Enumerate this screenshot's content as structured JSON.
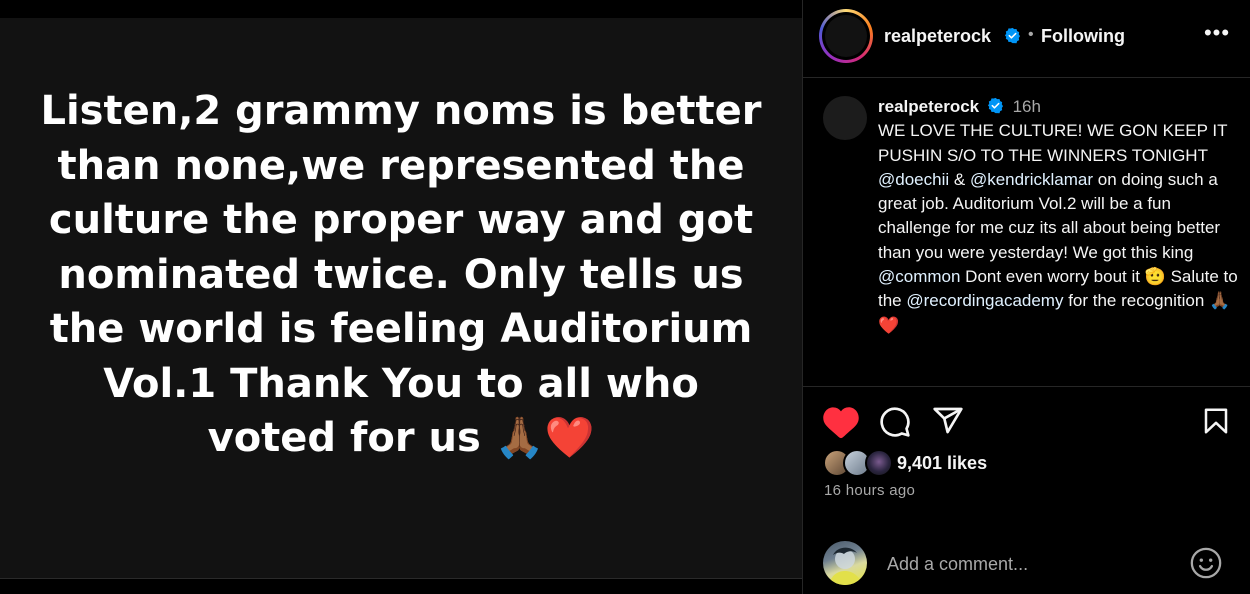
{
  "post": {
    "image_text": "Listen,2 grammy noms is better than none,we represented the culture the proper way and got nominated twice. Only tells us the world is feeling Auditorium Vol.1 Thank You to all who voted for us",
    "image_emoji": "🙏🏾❤️"
  },
  "header": {
    "username": "realpeterock",
    "separator": "•",
    "follow_status": "Following",
    "more": "•••"
  },
  "caption": {
    "username": "realpeterock",
    "time": "16h",
    "text_1": "WE LOVE THE CULTURE! WE GON KEEP IT PUSHIN S/O TO THE WINNERS TONIGHT ",
    "mention_1": "@doechii",
    "text_2": " & ",
    "mention_2": "@kendricklamar",
    "text_3": " on doing such a great job. Auditorium Vol.2 will be a fun challenge for me cuz its all about being better than you were yesterday! We got this king ",
    "mention_3": "@common",
    "text_4": " Dont even worry bout it 🫡 Salute to the ",
    "mention_4": "@recordingacademy",
    "text_5": " for the recognition 🙏🏾❤️"
  },
  "engagement": {
    "likes": "9,401 likes",
    "time_ago": "16 hours ago",
    "liked": true
  },
  "comment": {
    "placeholder": "Add a comment..."
  },
  "colors": {
    "like_red": "#ff3040",
    "verified_blue": "#0095f6",
    "mention": "#e0f1ff"
  },
  "icons": [
    "heart-icon",
    "comment-icon",
    "share-icon",
    "bookmark-icon",
    "verified-icon",
    "more-icon",
    "emoji-icon"
  ]
}
